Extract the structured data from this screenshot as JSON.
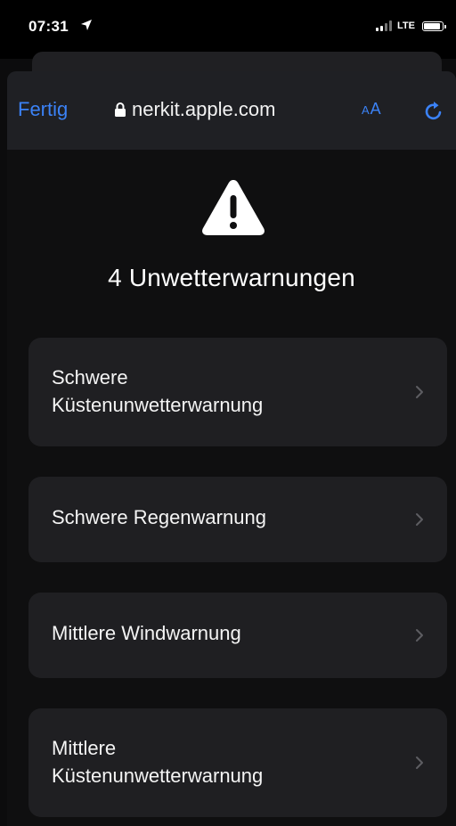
{
  "status": {
    "time": "07:31",
    "network": "LTE",
    "icons": [
      "location-arrow-icon",
      "signal-bars-icon",
      "battery-icon"
    ],
    "battery_level": 0.9
  },
  "navbar": {
    "done_label": "Fertig",
    "url": "nerkit.apple.com",
    "text_size_small": "A",
    "text_size_large": "A",
    "icons": [
      "lock-icon",
      "reload-icon"
    ]
  },
  "content": {
    "warning_icon": "exclamation-triangle-icon",
    "heading": "4 Unwetterwarnungen",
    "warnings": [
      {
        "line1": "Schwere",
        "line2": "Küstenunwetterwarnung"
      },
      {
        "line1": "Schwere Regenwarnung",
        "line2": ""
      },
      {
        "line1": "Mittlere Windwarnung",
        "line2": ""
      },
      {
        "line1": "Mittlere",
        "line2": "Küstenunwetterwarnung"
      }
    ]
  },
  "colors": {
    "accent": "#3b82f6",
    "background": "#0f0f10",
    "card": "#1f1f22",
    "toolbar": "#1f2024"
  }
}
